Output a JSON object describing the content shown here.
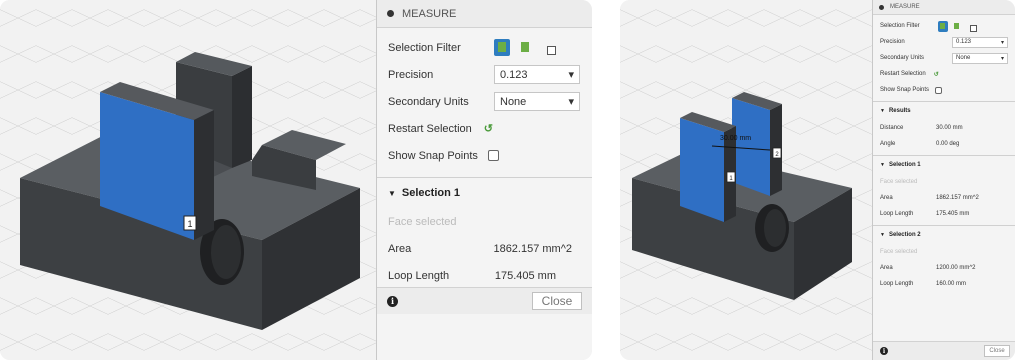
{
  "left": {
    "panel": {
      "title": "MEASURE",
      "selection_filter": {
        "label": "Selection Filter"
      },
      "precision": {
        "label": "Precision",
        "value": "0.123"
      },
      "secondary_units": {
        "label": "Secondary Units",
        "value": "None"
      },
      "restart_selection": {
        "label": "Restart Selection"
      },
      "show_snap_points": {
        "label": "Show Snap Points"
      },
      "selection1": {
        "header": "Selection 1",
        "status": "Face selected",
        "area_label": "Area",
        "area_value": "1862.157 mm^2",
        "loop_label": "Loop Length",
        "loop_value": "175.405 mm"
      },
      "close_label": "Close"
    },
    "viewport": {
      "face_label": "1"
    }
  },
  "right": {
    "panel": {
      "title": "MEASURE",
      "selection_filter": {
        "label": "Selection Filter"
      },
      "precision": {
        "label": "Precision",
        "value": "0.123"
      },
      "secondary_units": {
        "label": "Secondary Units",
        "value": "None"
      },
      "restart_selection": {
        "label": "Restart Selection"
      },
      "show_snap_points": {
        "label": "Show Snap Points"
      },
      "results": {
        "header": "Results",
        "distance_label": "Distance",
        "distance_value": "30.00 mm",
        "angle_label": "Angle",
        "angle_value": "0.00 deg"
      },
      "selection1": {
        "header": "Selection 1",
        "status": "Face selected",
        "area_label": "Area",
        "area_value": "1862.157 mm^2",
        "loop_label": "Loop Length",
        "loop_value": "175.405 mm"
      },
      "selection2": {
        "header": "Selection 2",
        "status": "Face selected",
        "area_label": "Area",
        "area_value": "1200.00 mm^2",
        "loop_label": "Loop Length",
        "loop_value": "160.00 mm"
      },
      "close_label": "Close"
    },
    "viewport": {
      "face1_label": "1",
      "face2_label": "2",
      "dimension_label": "30.00 mm"
    }
  },
  "colors": {
    "accent": "#2e7dbf",
    "selected_face": "#2f6fc4",
    "model_dark": "#3e4144",
    "restart_green": "#4a9a3a",
    "muted_text": "#bbbbbb"
  },
  "icons": [
    "settings-dot-icon",
    "body-filter-icon",
    "face-filter-icon",
    "edge-filter-icon",
    "dropdown-arrow-icon",
    "restart-arrow-icon",
    "checkbox-icon",
    "collapse-triangle-icon",
    "info-icon"
  ]
}
